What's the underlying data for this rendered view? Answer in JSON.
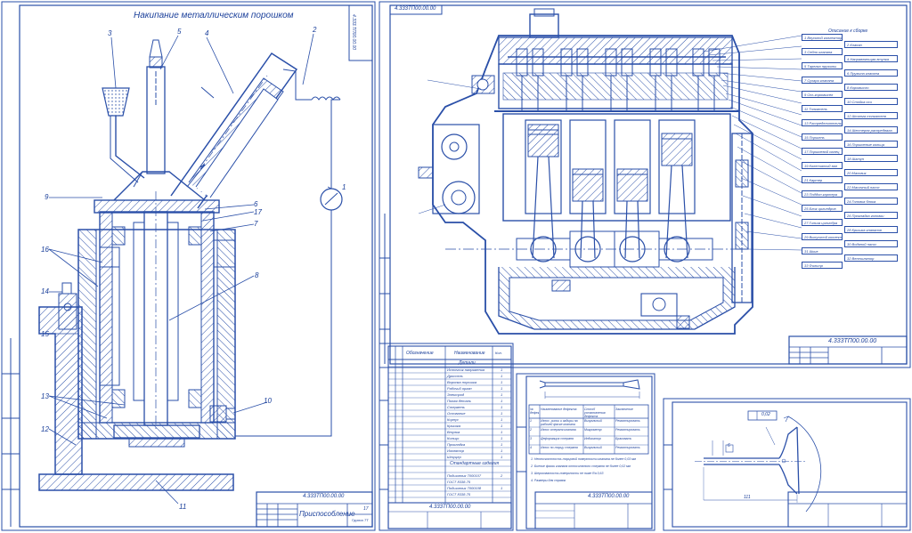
{
  "sheet1": {
    "title": "Накипание металлическим порошком",
    "doc_number": "4.333.ТП00.00.00",
    "stamp_number": "4.333ТП00.00.00",
    "stamp_title": "Приспособление",
    "stamp_sheet": "17",
    "stamp_group": "Группа ТТ"
  },
  "sheet2": {
    "doc_number": "4.333ТП00.00.00",
    "stamp_number": "4.333ТП00.00.00",
    "callout_header": "Описание к сборке",
    "callouts": [
      "1 Впускной коллектор",
      "2 Клапан",
      "3 Седло клапана",
      "4 Направляющая втулка",
      "5 Тарелка пружины",
      "6 Пружина клапана",
      "7 Сухари клапана",
      "8 Коромысло",
      "9 Ось коромысел",
      "10 Стойка оси",
      "11 Толкатель",
      "12 Штанга толкателя",
      "13 Распределительный вал",
      "14 Шестерня распредвала",
      "15 Поршень",
      "16 Поршневые кольца",
      "17 Поршневой палец",
      "18 Шатун",
      "19 Коленчатый вал",
      "20 Маховик",
      "21 Картер",
      "22 Масляный насос",
      "23 Поддон картера",
      "24 Головка блока",
      "25 Блок цилиндров",
      "26 Прокладка головки",
      "27 Гильза цилиндра",
      "28 Крышка клапанов",
      "29 Выпускной коллектор",
      "30 Водяной насос",
      "31 Шкив",
      "32 Вентилятор",
      "33 Фильтр"
    ]
  },
  "sheet3": {
    "stamp_number": "4.333ТП00.00.00",
    "col_headers": [
      "Обозначение",
      "Наименование",
      "Кол."
    ],
    "section_details": "Детали",
    "section_standard": "Стандартные изделия",
    "rows": [
      {
        "name": "Источник напряжения",
        "qty": "1"
      },
      {
        "name": "Дроссель",
        "qty": "1"
      },
      {
        "name": "Воронка порошка",
        "qty": "1"
      },
      {
        "name": "Рабочий орган",
        "qty": "1"
      },
      {
        "name": "Электрод",
        "qty": "1"
      },
      {
        "name": "Полая деталь",
        "qty": "1"
      },
      {
        "name": "Стержень",
        "qty": "1"
      },
      {
        "name": "Основание",
        "qty": "1"
      },
      {
        "name": "Корпус",
        "qty": "1"
      },
      {
        "name": "Крышка",
        "qty": "1"
      },
      {
        "name": "Втулка",
        "qty": "1"
      },
      {
        "name": "Кольцо",
        "qty": "1"
      },
      {
        "name": "Прокладка",
        "qty": "1"
      },
      {
        "name": "Изолятор",
        "qty": "1"
      },
      {
        "name": "Штуцер",
        "qty": "1"
      }
    ],
    "std_rows": [
      {
        "name": "Подшипник 7000107",
        "qty": "2"
      },
      {
        "name": "ГОСТ 8338-75",
        "qty": ""
      },
      {
        "name": "Подшипник 7000108",
        "qty": "1"
      },
      {
        "name": "ГОСТ 8338-75",
        "qty": ""
      }
    ]
  },
  "sheet4": {
    "stamp_number": "4.333ТП00.00.00",
    "headers": [
      "№ дефекта",
      "Наименование дефекта",
      "Способ установления дефекта",
      "Заключение"
    ],
    "rows": [
      [
        "1",
        "Износ, риски и задиры на рабочей фаске клапана",
        "Визуальный",
        "Ремонтировать"
      ],
      [
        "2",
        "Износ стержня клапана",
        "Микрометр",
        "Ремонтировать"
      ],
      [
        "3",
        "Деформация стержня",
        "Индикатор",
        "Браковать"
      ],
      [
        "4",
        "Износ по торцу стержня",
        "Визуальный",
        "Ремонтировать"
      ]
    ],
    "notes": [
      "1. Неплоскостность торцовой поверхности клапана не более 0,03 мм",
      "2. Биение фаски клапана относительно стержня не более 0,02 мм",
      "3. Шероховатость поверхности не ниже Ra 0,63",
      "4. Размеры для справок"
    ]
  },
  "sheet5": {
    "tolerance": "0,02",
    "dim_a": "6",
    "dim_b": "111"
  }
}
